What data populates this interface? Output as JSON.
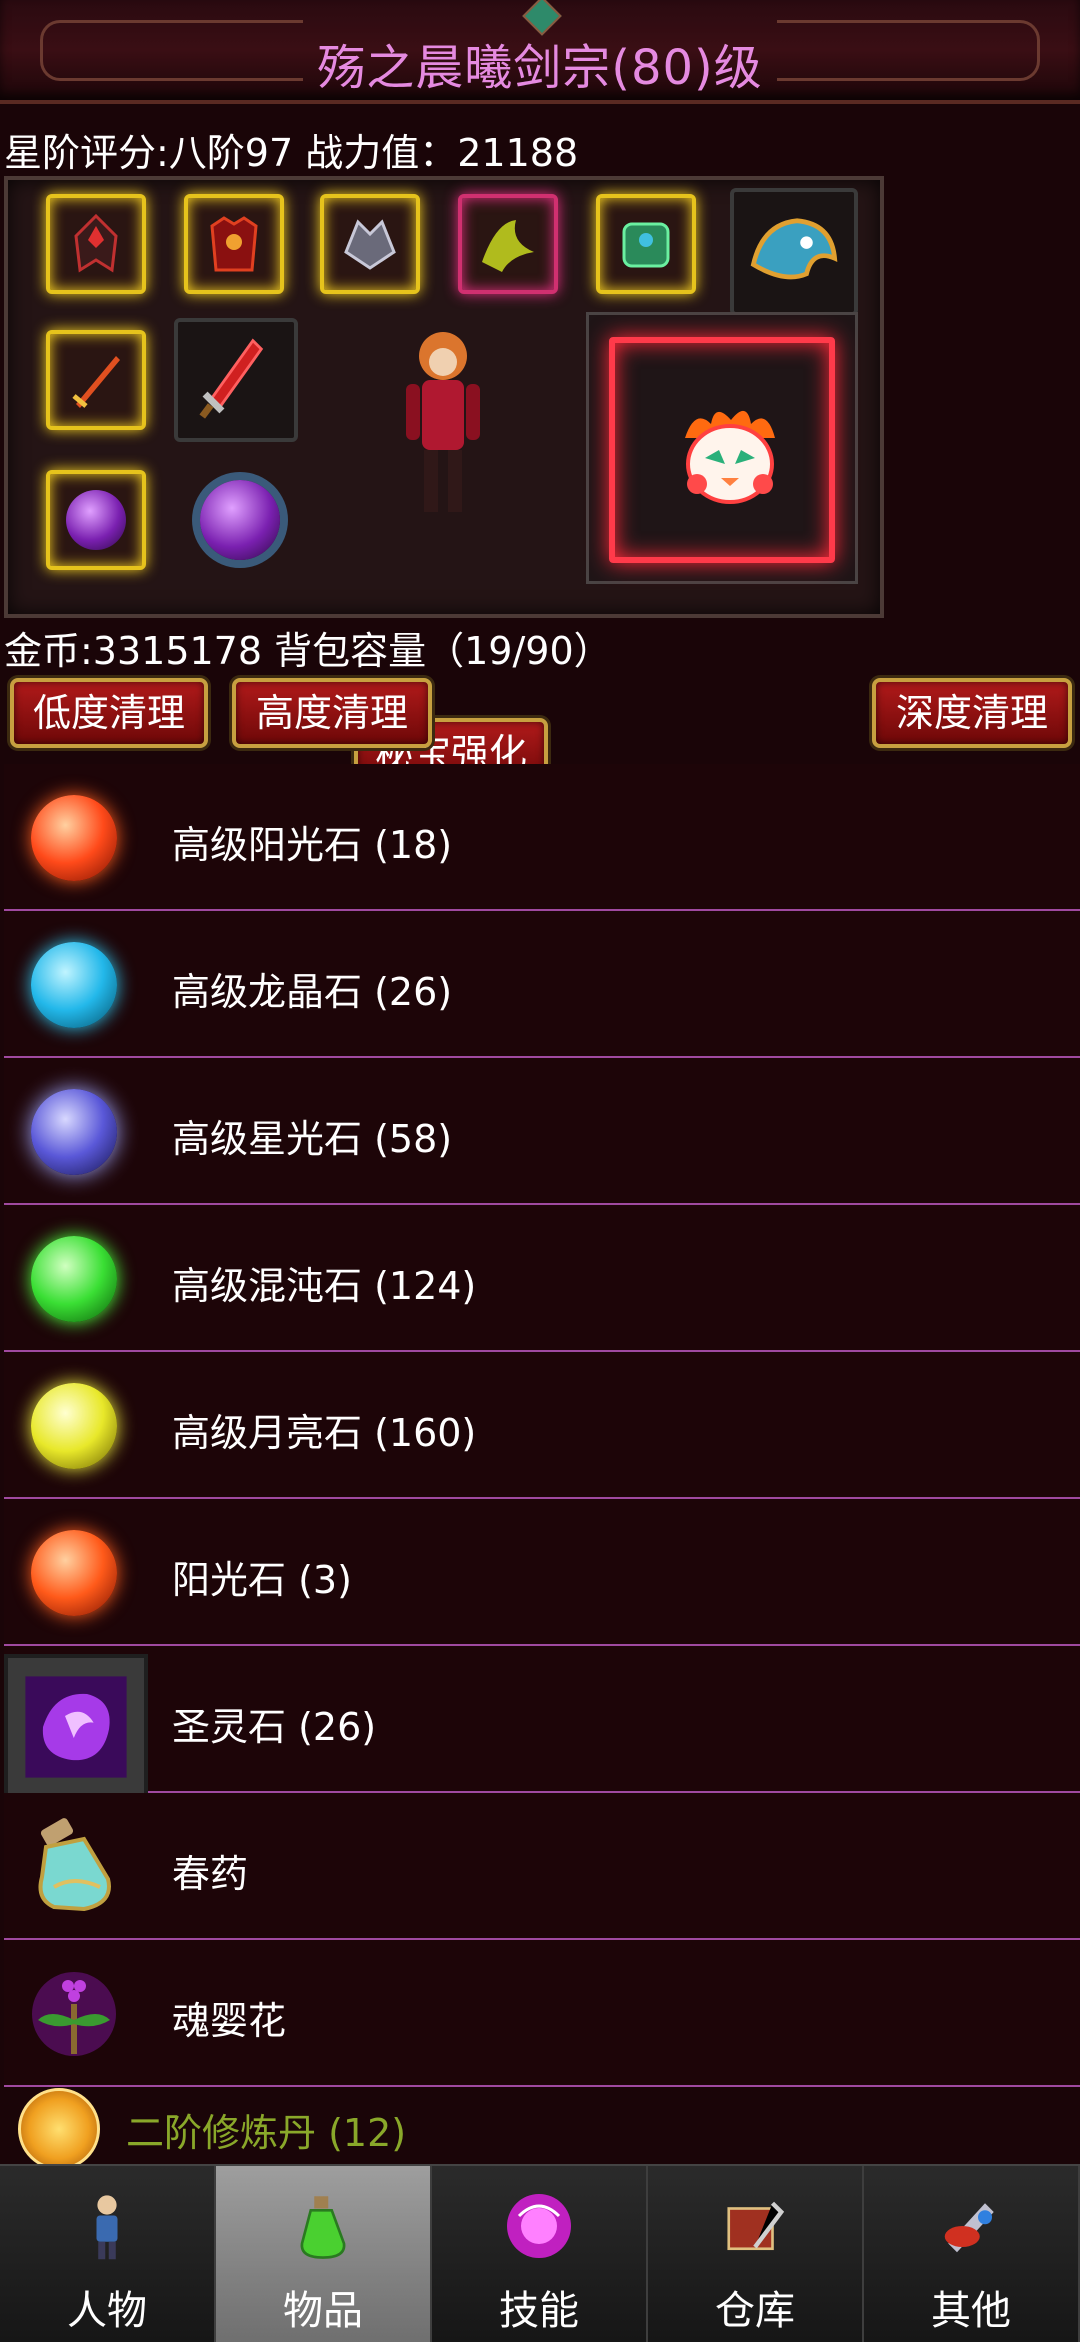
{
  "header": {
    "title": "殇之晨曦剑宗(80)级"
  },
  "stats": {
    "line": "星阶评分:八阶97 战力值：21188"
  },
  "equipment": {
    "secret_button": "秘宝强化"
  },
  "bag": {
    "gold_line": "金币:3315178 背包容量（19/90）",
    "clean_low": "低度清理",
    "clean_high": "高度清理",
    "clean_deep": "深度清理"
  },
  "items": [
    {
      "name": "高级阳光石 (18)",
      "icon": "sun-stone-icon",
      "color": "#ff4a1a"
    },
    {
      "name": "高级龙晶石 (26)",
      "icon": "dragon-crystal-icon",
      "color": "#23b8ea"
    },
    {
      "name": "高级星光石 (58)",
      "icon": "starlight-stone-icon",
      "color": "#5a58d8"
    },
    {
      "name": "高级混沌石 (124)",
      "icon": "chaos-stone-icon",
      "color": "#3adf34"
    },
    {
      "name": "高级月亮石 (160)",
      "icon": "moon-stone-icon",
      "color": "#e8e82a"
    },
    {
      "name": "阳光石 (3)",
      "icon": "sun-stone-icon",
      "color": "#ff5a1a"
    },
    {
      "name": "圣灵石 (26)",
      "icon": "holy-spirit-stone-icon",
      "color": "#a63ae8"
    },
    {
      "name": "春药",
      "icon": "potion-bottle-icon",
      "color": "#7ad8d0"
    },
    {
      "name": "魂婴花",
      "icon": "soul-flower-icon",
      "color": "#b030c0"
    }
  ],
  "last_item": {
    "name": "二阶修炼丹 (12)"
  },
  "tabs": [
    {
      "label": "人物",
      "icon": "character-icon"
    },
    {
      "label": "物品",
      "icon": "items-potion-icon"
    },
    {
      "label": "技能",
      "icon": "skill-orb-icon"
    },
    {
      "label": "仓库",
      "icon": "warehouse-icon"
    },
    {
      "label": "其他",
      "icon": "other-icon"
    }
  ],
  "active_tab": "物品"
}
